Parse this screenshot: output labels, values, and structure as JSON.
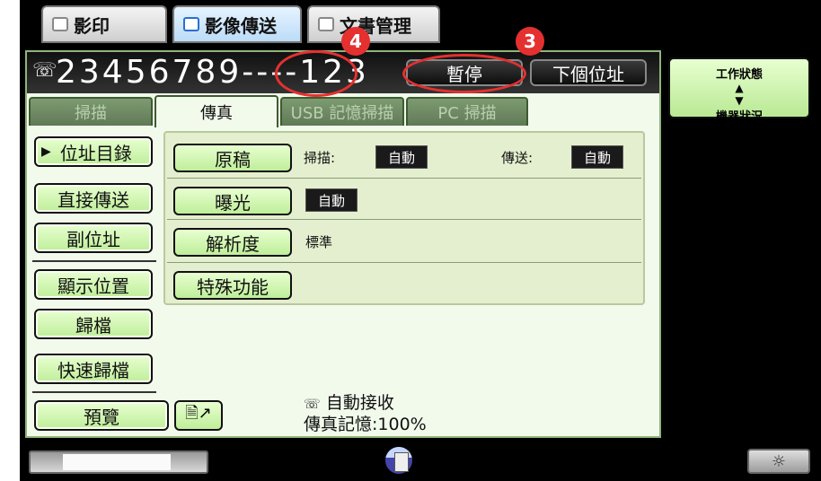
{
  "mode_tabs": [
    {
      "label": "影印",
      "icon": "copy-icon"
    },
    {
      "label": "影像傳送",
      "icon": "image-send-icon"
    },
    {
      "label": "文書管理",
      "icon": "document-filing-icon"
    }
  ],
  "number_display": "23456789----123",
  "header_buttons": {
    "pause": "暫停",
    "next_address": "下個位址"
  },
  "function_tabs": [
    "掃描",
    "傳真",
    "USB 記憶掃描",
    "PC 掃描"
  ],
  "left_buttons": [
    "位址目錄",
    "直接傳送",
    "副位址",
    "顯示位置",
    "歸檔",
    "快速歸檔",
    "預覽"
  ],
  "settings": {
    "original": {
      "label": "原稿",
      "scan_label": "掃描:",
      "scan_value": "自動",
      "send_label": "傳送:",
      "send_value": "自動"
    },
    "exposure": {
      "label": "曝光",
      "value": "自動"
    },
    "resolution": {
      "label": "解析度",
      "value": "標準"
    },
    "special": {
      "label": "特殊功能"
    }
  },
  "status": {
    "auto_receive": "自動接收",
    "fax_memory": "傳真記憶:100%"
  },
  "side_panel": {
    "job_status": "工作狀態",
    "machine_status": "機器狀況"
  },
  "annotations": [
    "4",
    "3"
  ],
  "colors": {
    "accent_green": "#bfee9a",
    "annotation_red": "#e53030",
    "panel_bg": "#f2faec"
  }
}
